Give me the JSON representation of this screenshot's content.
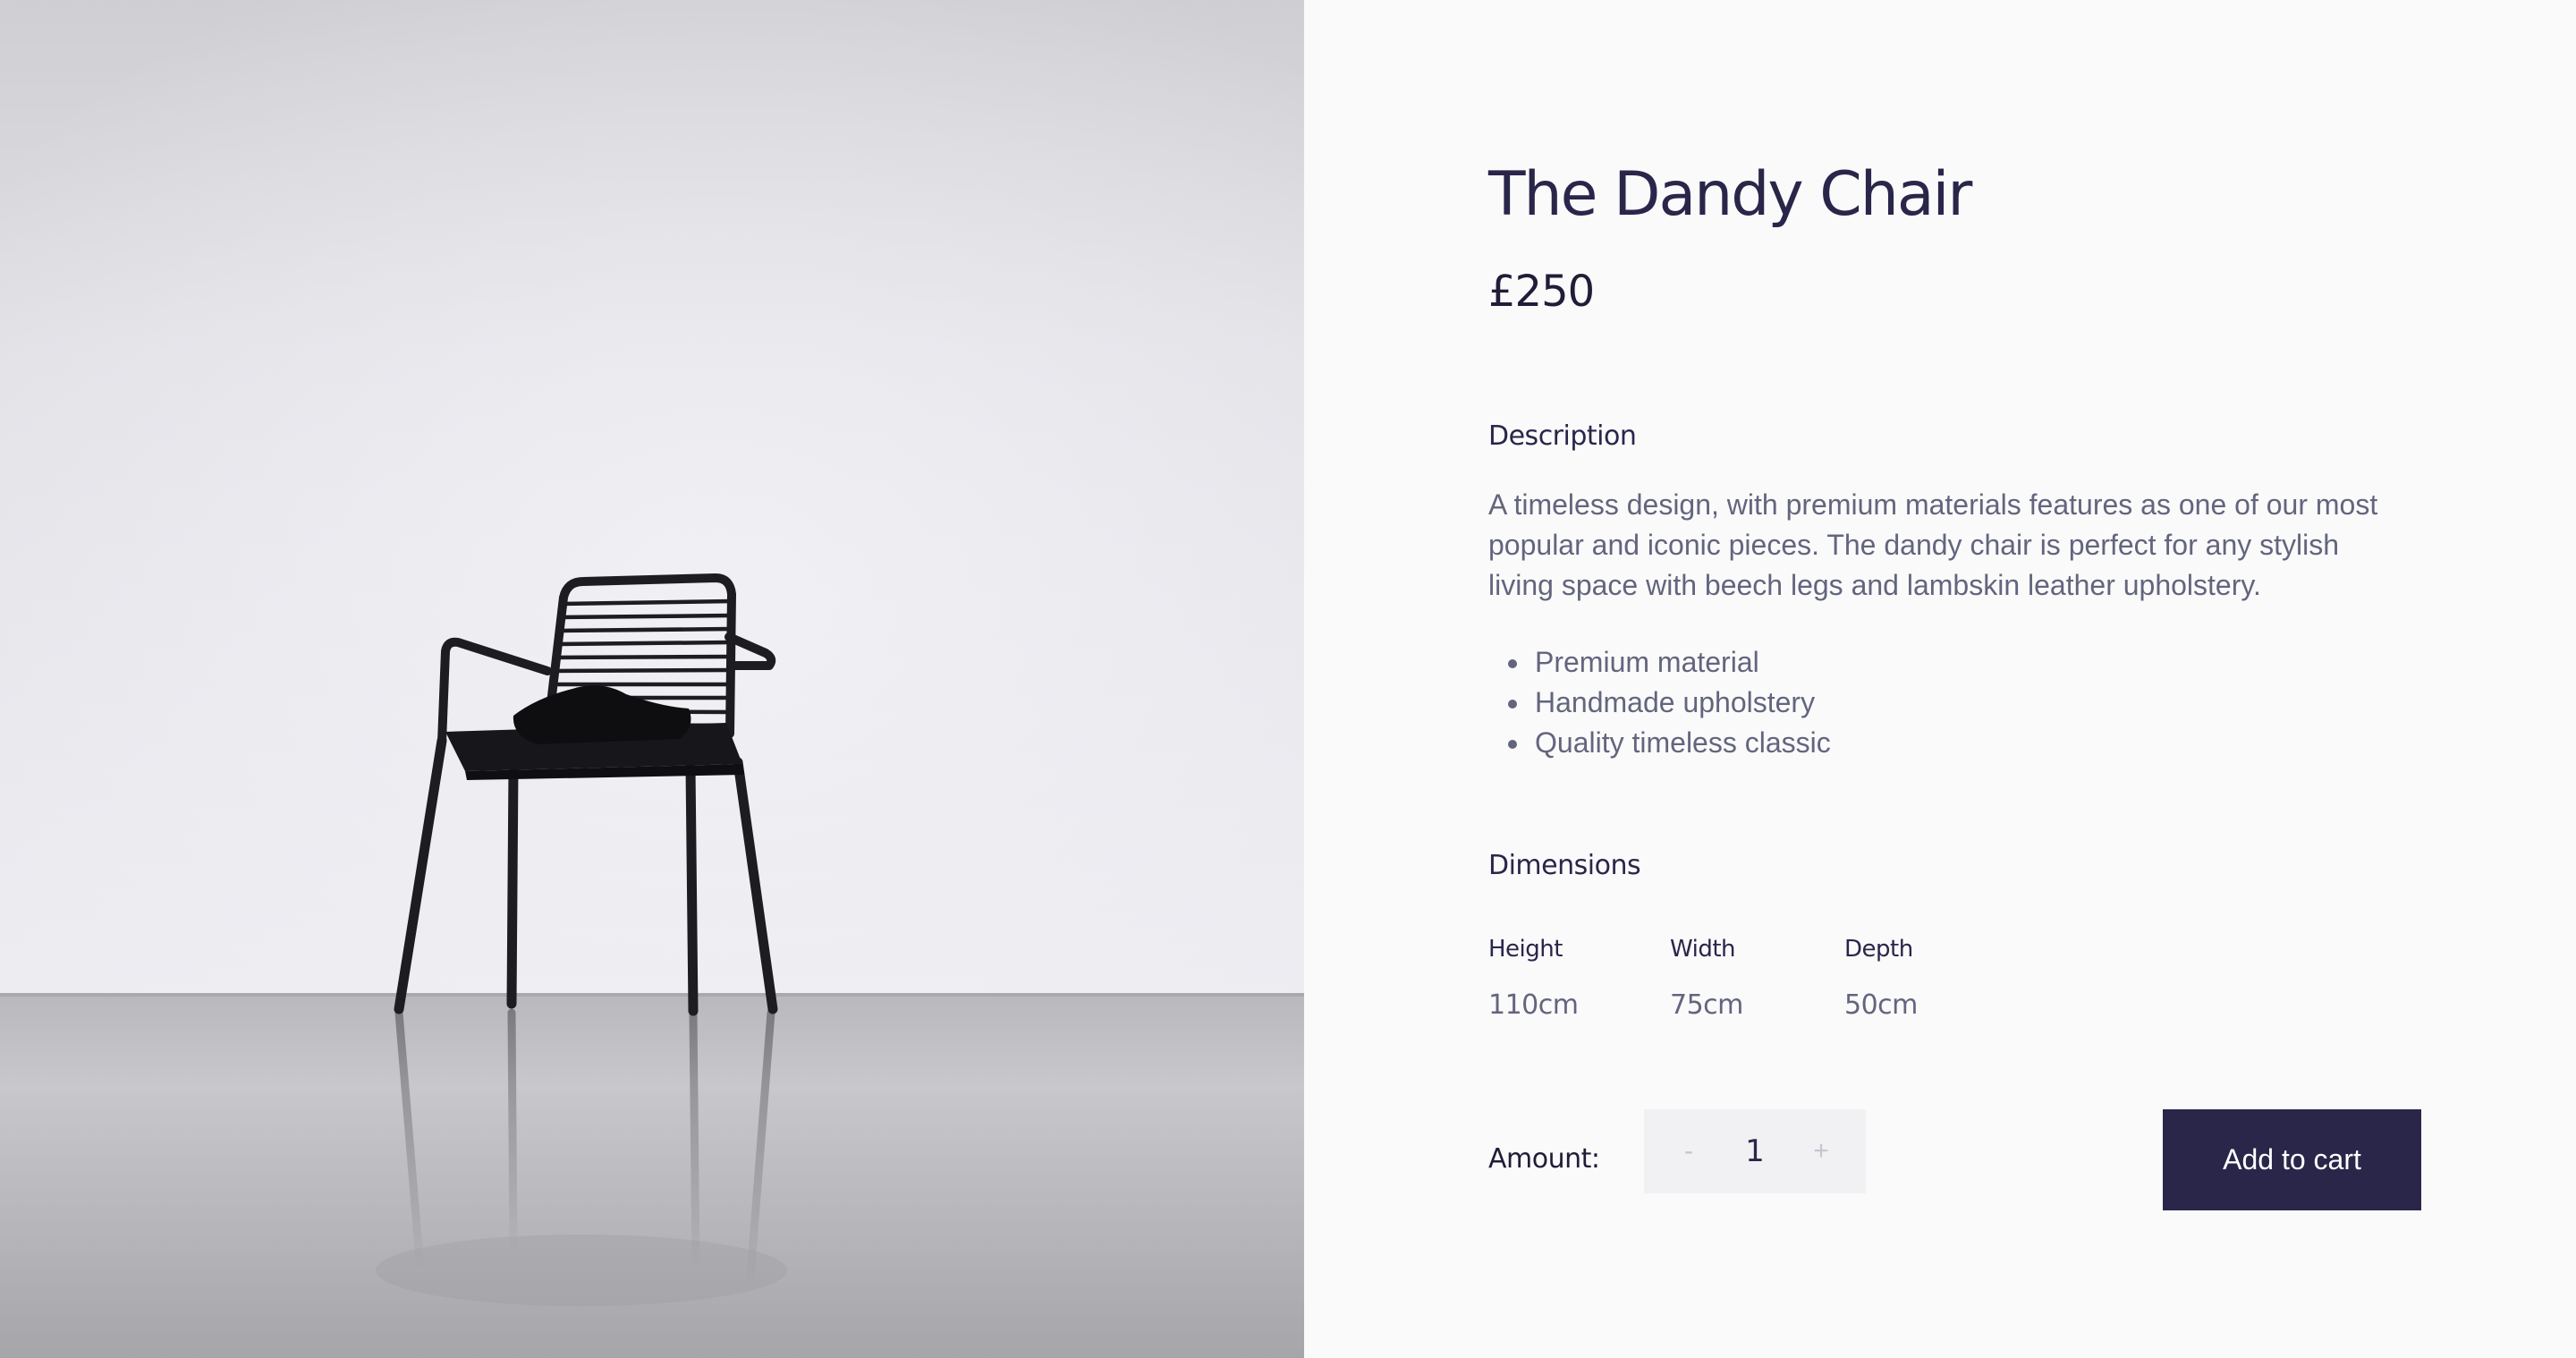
{
  "product": {
    "title": "The Dandy Chair",
    "price": "£250",
    "image_subject": "black metal armchair"
  },
  "description": {
    "heading": "Description",
    "text": "A timeless design, with premium materials features as one of our most popular and iconic pieces. The dandy chair is perfect for any stylish living space with beech legs and lambskin leather upholstery.",
    "features": [
      "Premium material",
      "Handmade upholstery",
      "Quality timeless classic"
    ]
  },
  "dimensions": {
    "heading": "Dimensions",
    "items": [
      {
        "label": "Height",
        "value": "110cm"
      },
      {
        "label": "Width",
        "value": "75cm"
      },
      {
        "label": "Depth",
        "value": "50cm"
      }
    ]
  },
  "purchase": {
    "amount_label": "Amount:",
    "decrement_label": "-",
    "quantity": "1",
    "increment_label": "+",
    "add_to_cart_label": "Add to cart"
  },
  "colors": {
    "accent": "#29264a",
    "body_text": "#63657e",
    "panel_background": "#fafafa",
    "stepper_background": "#f1f1f3"
  }
}
